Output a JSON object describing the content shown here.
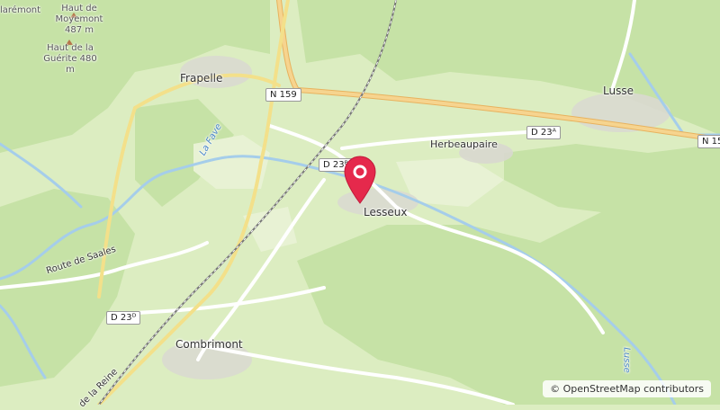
{
  "map": {
    "attribution": "© OpenStreetMap contributors",
    "marker": {
      "label": "location-marker",
      "color": "#e5294c"
    },
    "places": {
      "frapelle": "Frapelle",
      "lusse": "Lusse",
      "lesseux": "Lesseux",
      "combrimont": "Combrimont",
      "herbeaupaire": "Herbeaupaire",
      "claremont": "larémont"
    },
    "peaks": {
      "moyemont": "Haut de Moyemont 487 m",
      "guerite": "Haut de la Guérite 480 m"
    },
    "roads": {
      "n159_left": "N 159",
      "n159_right": "N 15",
      "d23a": "D 23ᴬ",
      "d23b": "D 23ᴮ",
      "d23d": "D 23ᴰ",
      "route_saales": "Route de Saales",
      "la_reine": "de la Reine"
    },
    "water": {
      "la_fave": "La Fave",
      "lusse_river": "Lusse"
    },
    "colors": {
      "forest": "#c3e0a3",
      "meadow": "#dcedc1",
      "trunk_road": "#f3c97a",
      "water": "#a5cdea",
      "rail": "#777777"
    }
  }
}
